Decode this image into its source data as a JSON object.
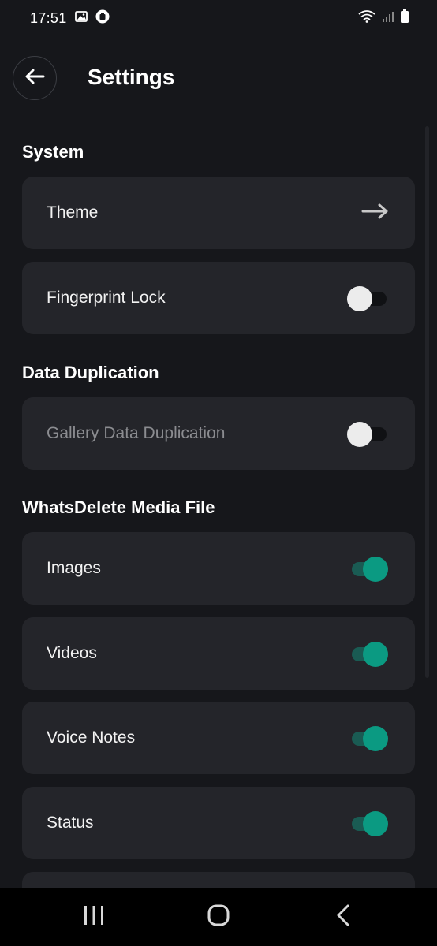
{
  "status_bar": {
    "time": "17:51",
    "icons": [
      "gallery-icon",
      "app-notification-icon",
      "wifi-icon",
      "signal-icon",
      "battery-icon"
    ]
  },
  "header": {
    "title": "Settings",
    "back_icon": "arrow-left-icon"
  },
  "sections": {
    "system": {
      "title": "System",
      "theme": {
        "label": "Theme",
        "icon": "arrow-right-icon"
      },
      "fingerprint_lock": {
        "label": "Fingerprint Lock",
        "enabled": false
      }
    },
    "data_duplication": {
      "title": "Data Duplication",
      "gallery": {
        "label": "Gallery Data Duplication",
        "enabled": false,
        "disabled": true
      }
    },
    "media": {
      "title": "WhatsDelete Media File",
      "images": {
        "label": "Images",
        "enabled": true
      },
      "videos": {
        "label": "Videos",
        "enabled": true
      },
      "voice_notes": {
        "label": "Voice Notes",
        "enabled": true
      },
      "status": {
        "label": "Status",
        "enabled": true
      }
    }
  },
  "nav_bar": {
    "recents_icon": "recent-apps-icon",
    "home_icon": "home-icon",
    "back_icon": "back-chevron-icon"
  },
  "colors": {
    "background": "#16171b",
    "card": "#24252a",
    "accent": "#0b9a82",
    "accent_track": "#1a5b53"
  }
}
